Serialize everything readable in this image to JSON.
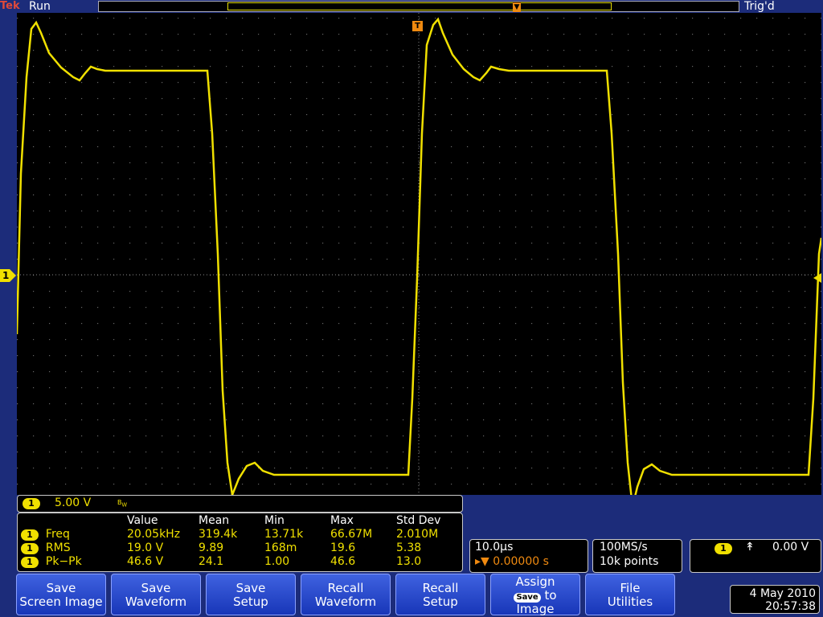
{
  "status": {
    "brand": "Tek",
    "run_state": "Run",
    "trigger_state": "Trig'd"
  },
  "trigger_marker": "T",
  "channel_marker": "1",
  "channel": {
    "number": "1",
    "scale": "5.00 V",
    "bw_icon": "bandwidth-limit-icon"
  },
  "measurements": {
    "headers": [
      "",
      "Value",
      "Mean",
      "Min",
      "Max",
      "Std Dev"
    ],
    "rows": [
      {
        "ch": "1",
        "name": "Freq",
        "value": "20.05kHz",
        "mean": "319.4k",
        "min": "13.71k",
        "max": "66.67M",
        "std": "2.010M"
      },
      {
        "ch": "1",
        "name": "RMS",
        "value": "19.0 V",
        "mean": "9.89",
        "min": "168m",
        "max": "19.6",
        "std": "5.38"
      },
      {
        "ch": "1",
        "name": "Pk−Pk",
        "value": "46.6 V",
        "mean": "24.1",
        "min": "1.00",
        "max": "46.6",
        "std": "13.0"
      }
    ]
  },
  "timebase": {
    "scale": "10.0µs",
    "position": "0.00000 s"
  },
  "acquisition": {
    "rate": "100MS/s",
    "record": "10k points"
  },
  "trigger": {
    "source": "1",
    "slope_icon": "rising-edge-icon",
    "level": "0.00 V"
  },
  "buttons": [
    {
      "l1": "Save",
      "l2": "Screen Image"
    },
    {
      "l1": "Save",
      "l2": "Waveform"
    },
    {
      "l1": "Save",
      "l2": "Setup"
    },
    {
      "l1": "Recall",
      "l2": "Waveform"
    },
    {
      "l1": "Recall",
      "l2": "Setup"
    },
    {
      "l1": "Assign",
      "chip": "Save",
      "to": "to",
      "l2": "Image"
    },
    {
      "l1": "File",
      "l2": "Utilities"
    }
  ],
  "datetime": {
    "date": "4 May 2010",
    "time": "20:57:38"
  },
  "colors": {
    "trace": "#f0e000",
    "accent": "#f08a10",
    "background": "#000000",
    "frame": "#1c2c7a"
  }
}
